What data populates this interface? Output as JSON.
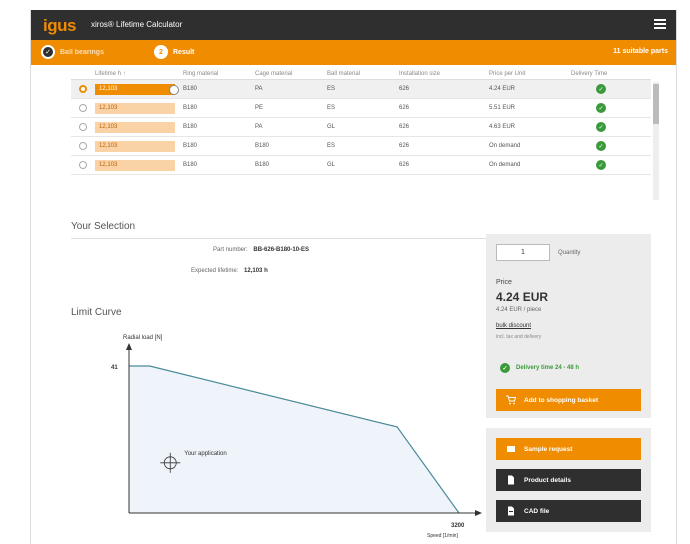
{
  "header": {
    "logo": "igus",
    "title": "xiros® Lifetime Calculator",
    "menu_icon": "hamburger-menu-icon"
  },
  "steps": {
    "step1_label": "Ball bearings",
    "step2_number": "2",
    "step2_label": "Result",
    "suitable_parts": "11 suitable parts"
  },
  "table": {
    "headers": [
      "Lifetime h ↑",
      "Ring material",
      "Cage material",
      "Ball material",
      "Installation size",
      "Price per Unit",
      "Delivery Time"
    ],
    "rows": [
      {
        "life": "12,103",
        "ring": "B180",
        "cage": "PA",
        "ball": "ES",
        "size": "626",
        "price": "4.24 EUR",
        "selected": true
      },
      {
        "life": "12,103",
        "ring": "B180",
        "cage": "PE",
        "ball": "ES",
        "size": "626",
        "price": "5.51 EUR",
        "selected": false
      },
      {
        "life": "12,103",
        "ring": "B180",
        "cage": "PA",
        "ball": "GL",
        "size": "626",
        "price": "4.63 EUR",
        "selected": false
      },
      {
        "life": "12,103",
        "ring": "B180",
        "cage": "B180",
        "ball": "ES",
        "size": "626",
        "price": "On demand",
        "selected": false
      },
      {
        "life": "12,103",
        "ring": "B180",
        "cage": "B180",
        "ball": "GL",
        "size": "626",
        "price": "On demand",
        "selected": false
      }
    ]
  },
  "selection": {
    "title": "Your Selection",
    "part_label": "Part number",
    "part_value": "BB-626-B180-10-ES",
    "life_label": "Expected lifetime",
    "life_value": "12,103 h"
  },
  "limit_curve": {
    "title": "Limit Curve"
  },
  "chart_data": {
    "type": "line",
    "ylabel": "Radial load [N]",
    "xlabel": "Speed [1/min]",
    "y_tick": "41",
    "x_tick": "3200",
    "xlim": [
      0,
      3200
    ],
    "ylim": [
      0,
      41
    ],
    "series": [
      {
        "x": [
          0,
          200,
          2600,
          3200
        ],
        "y": [
          41,
          41,
          24,
          0
        ]
      }
    ],
    "annotation": "Your application",
    "annotation_point": [
      400,
      14
    ]
  },
  "price_panel": {
    "quantity": "1",
    "quantity_label": "Quantity",
    "price_label": "Price",
    "price_value": "4.24 EUR",
    "price_unit": "4.24 EUR / piece",
    "bulk_label": "bulk discount",
    "incl_label": "incl. tax and delivery",
    "delivery": "Delivery time 24 - 48 h",
    "cart_button": "Add to shopping basket"
  },
  "actions": {
    "sample": "Sample request",
    "product": "Product details",
    "cad": "CAD file"
  },
  "colors": {
    "accent": "#f08c00",
    "dark": "#2f2f2f",
    "green": "#3a9a3a",
    "curve": "#4a8a9a",
    "fill": "#eef4fa"
  }
}
